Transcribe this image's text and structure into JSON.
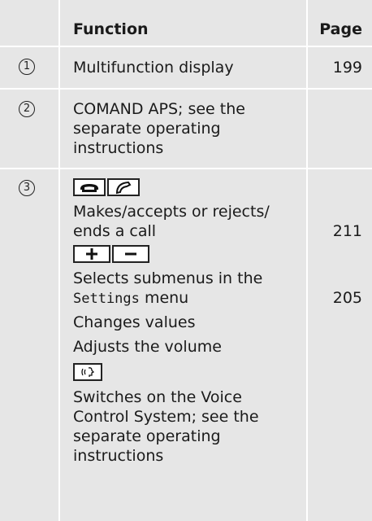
{
  "header": {
    "function_label": "Function",
    "page_label": "Page"
  },
  "rows": [
    {
      "number": "1",
      "function": "Multifunction display",
      "page": "199"
    },
    {
      "number": "2",
      "function_lines": [
        "COMAND APS; see the",
        "separate operating",
        "instructions"
      ],
      "page": ""
    },
    {
      "number": "3",
      "phone_keys_icons": [
        "phone-hangup-icon",
        "phone-accept-icon"
      ],
      "call_lines": [
        "Makes/accepts or rejects/",
        "ends a call"
      ],
      "call_page": "211",
      "plus_minus_icons": [
        "plus-icon",
        "minus-icon"
      ],
      "submenu_line1": "Selects submenus in the",
      "submenu_settings": "Settings",
      "submenu_menu": "menu",
      "submenu_page": "205",
      "changes_values": "Changes values",
      "adjusts_volume": "Adjusts the volume",
      "voice_icon": "voice-control-icon",
      "voice_lines": [
        "Switches on the Voice",
        "Control System; see the",
        "separate operating",
        "instructions"
      ]
    }
  ]
}
